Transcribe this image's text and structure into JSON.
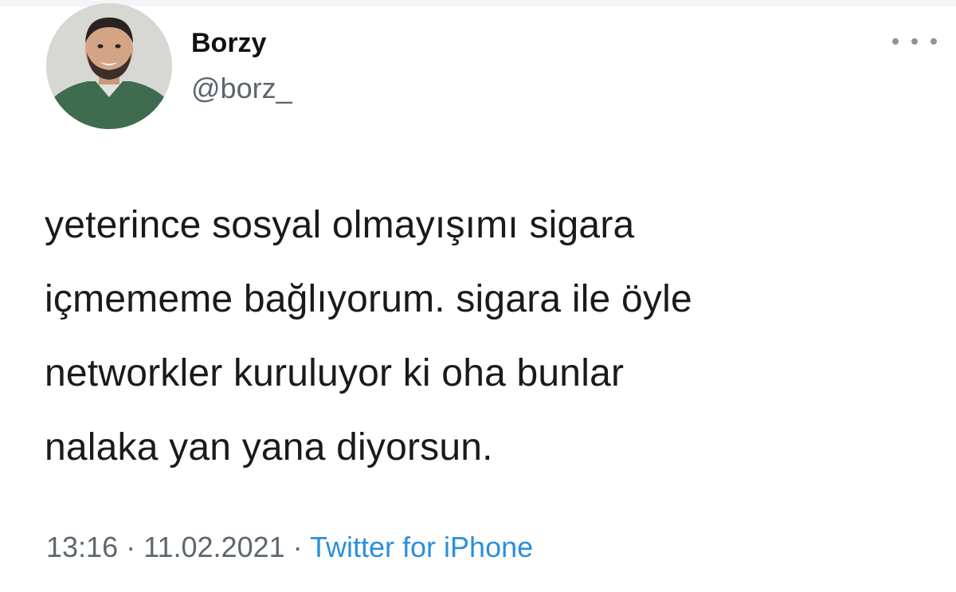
{
  "author": {
    "name": "Borzy",
    "handle": "@borz_"
  },
  "tweet": {
    "lines": [
      "yeterince sosyal olmayışımı sigara",
      "içmememe bağlıyorum. sigara ile öyle",
      "networkler kuruluyor ki oha bunlar",
      "nalaka yan yana diyorsun."
    ]
  },
  "meta": {
    "time": "13:16",
    "separator": "·",
    "date": "11.02.2021",
    "source": "Twitter for iPhone"
  },
  "icons": {
    "more": "more-horizontal-icon"
  },
  "colors": {
    "source_link": "#2b8fdc",
    "secondary_text": "#5e6670"
  }
}
